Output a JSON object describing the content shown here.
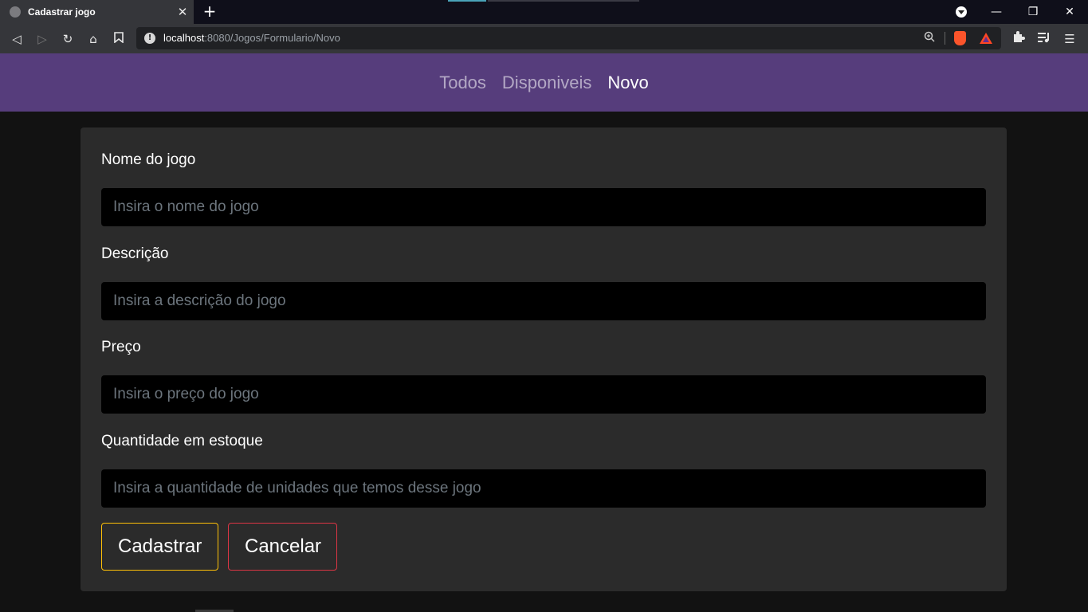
{
  "browser": {
    "tab_title": "Cadastrar jogo",
    "tab_close": "✕",
    "new_tab": "+",
    "url_host": "localhost",
    "url_rest": ":8080/Jogos/Formulario/Novo",
    "win_minimize": "—",
    "win_restore": "❐",
    "win_close": "✕"
  },
  "nav": {
    "items": [
      {
        "label": "Todos",
        "active": false
      },
      {
        "label": "Disponiveis",
        "active": false
      },
      {
        "label": "Novo",
        "active": true
      }
    ],
    "bg_color": "#563d7c"
  },
  "form": {
    "fields": [
      {
        "label": "Nome do jogo",
        "placeholder": "Insira o nome do jogo",
        "value": ""
      },
      {
        "label": "Descrição",
        "placeholder": "Insira a descrição do jogo",
        "value": ""
      },
      {
        "label": "Preço",
        "placeholder": "Insira o preço do jogo",
        "value": ""
      },
      {
        "label": "Quantidade em estoque",
        "placeholder": "Insira a quantidade de unidades que temos desse jogo",
        "value": ""
      }
    ],
    "submit_label": "Cadastrar",
    "cancel_label": "Cancelar",
    "submit_border_color": "#ffc107",
    "cancel_border_color": "#dc3545"
  }
}
